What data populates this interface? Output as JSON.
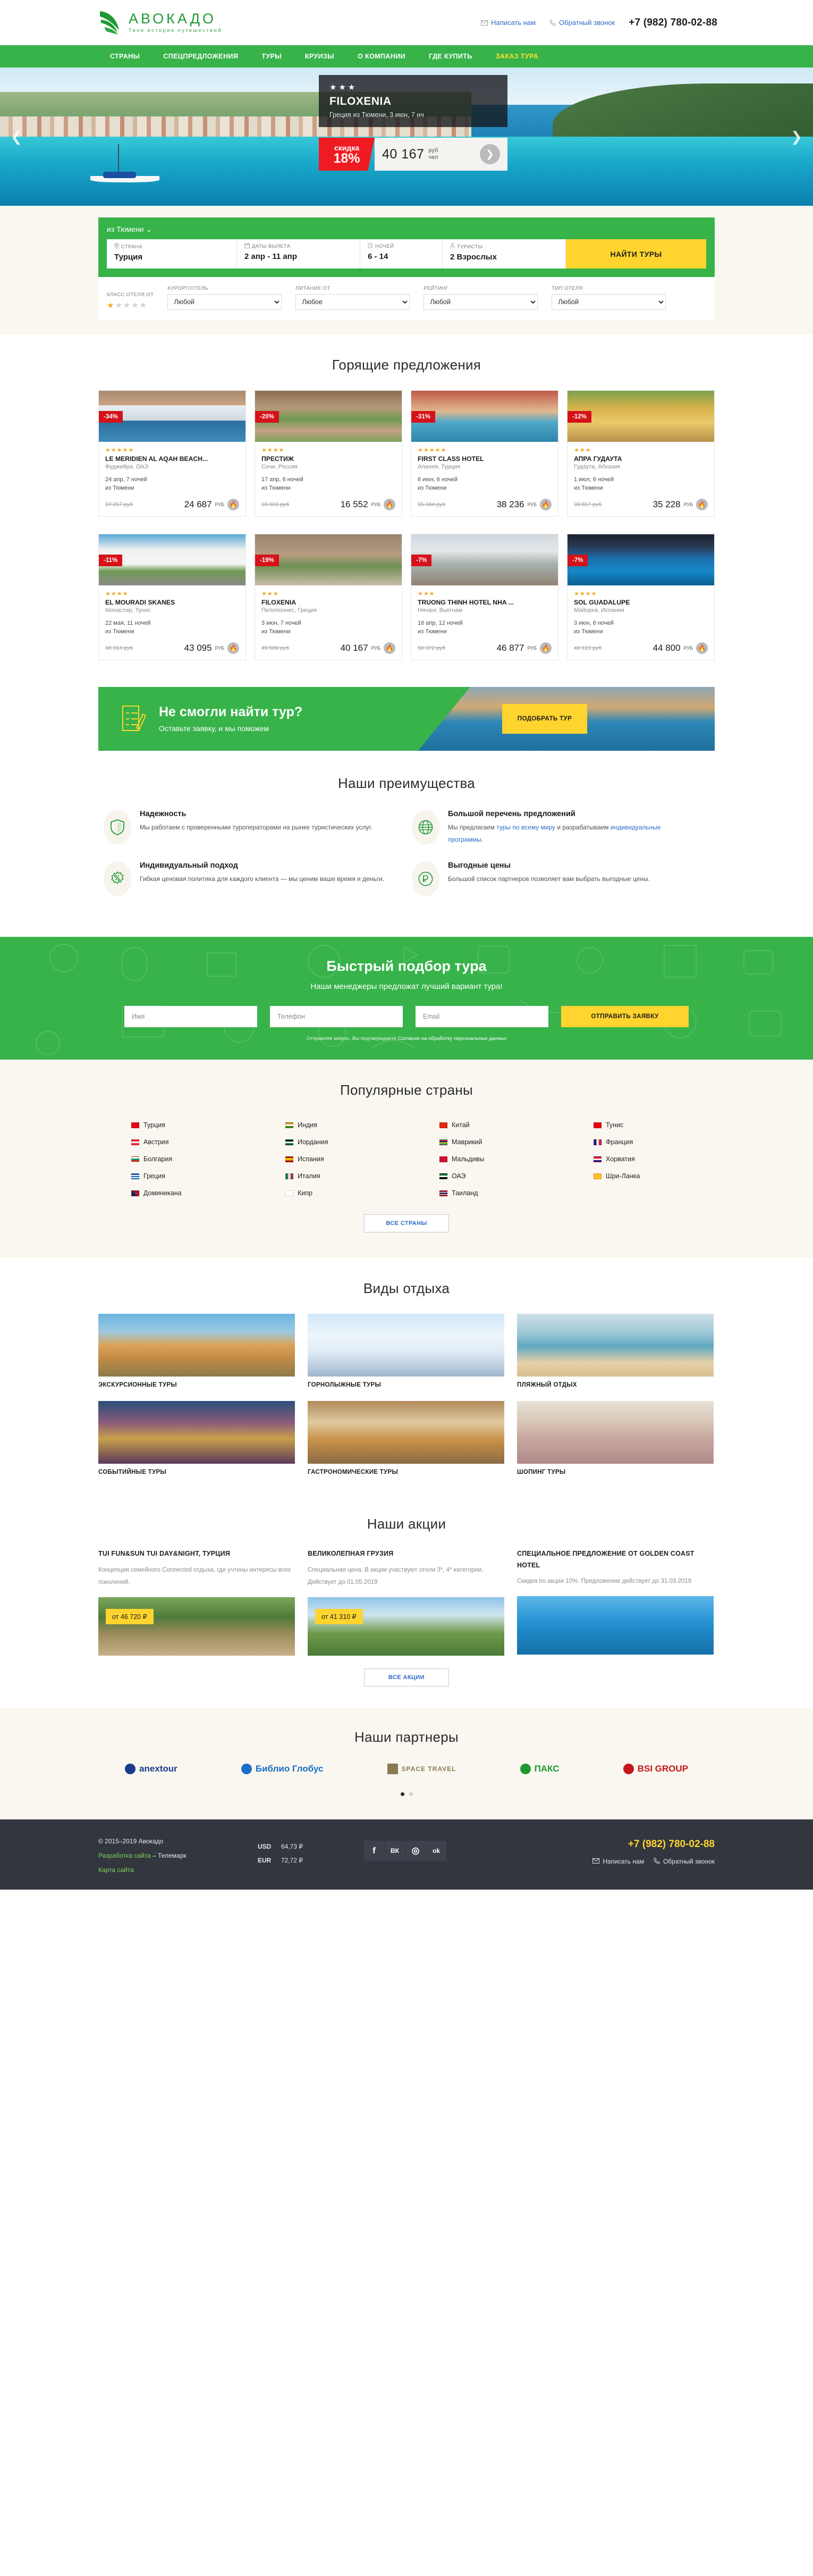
{
  "header": {
    "logo_title": "АВОКАДО",
    "logo_sub": "Твоя история путешествий",
    "write_us": "Написать нам",
    "callback": "Обратный звонок",
    "phone": "+7 (982) 780-02-88"
  },
  "nav": [
    {
      "label": "СТРАНЫ",
      "accent": false
    },
    {
      "label": "СПЕЦПРЕДЛОЖЕНИЯ",
      "accent": false
    },
    {
      "label": "ТУРЫ",
      "accent": false
    },
    {
      "label": "КРУИЗЫ",
      "accent": false
    },
    {
      "label": "О КОМПАНИИ",
      "accent": false
    },
    {
      "label": "ГДЕ КУПИТЬ",
      "accent": false
    },
    {
      "label": "ЗАКАЗ ТУРА",
      "accent": true
    }
  ],
  "hero": {
    "stars": "★★★",
    "hotel": "FILOXENIA",
    "meta": "Греция из Тюмени, 3 июн, 7 нч",
    "discount_label": "скидка",
    "discount_value": "18%",
    "price": "40 167",
    "unit_top": "руб",
    "unit_bottom": "чел",
    "prev_icon": "chevron-left-icon",
    "next_icon": "chevron-right-icon"
  },
  "search": {
    "from_city": "из Тюмени",
    "fields": [
      {
        "label": "СТРАНА",
        "value": "Турция",
        "icon": "pin-icon"
      },
      {
        "label": "ДАТЫ ВЫЛЕТА",
        "value": "2 апр - 11 апр",
        "icon": "calendar-icon"
      },
      {
        "label": "НОЧЕЙ",
        "value": "6 - 14",
        "icon": "clock-icon"
      },
      {
        "label": "ТУРИСТЫ",
        "value": "2 Взрослых",
        "icon": "person-icon"
      }
    ],
    "find_button": "НАЙТИ ТУРЫ",
    "filters": [
      {
        "label": "КЛАСС ОТЕЛЯ ОТ",
        "type": "stars",
        "filled": 1,
        "total": 5
      },
      {
        "label": "КУРОРТ/ОТЕЛЬ",
        "type": "select",
        "value": "Любой"
      },
      {
        "label": "ПИТАНИЕ ОТ",
        "type": "select",
        "value": "Любое"
      },
      {
        "label": "РЕЙТИНГ",
        "type": "select",
        "value": "Любой"
      },
      {
        "label": "ТИП ОТЕЛЯ",
        "type": "select",
        "value": "Любой"
      }
    ]
  },
  "hot_offers": {
    "title": "Горящие предложения",
    "currency": "РУБ",
    "cards": [
      {
        "discount": "-34%",
        "stars": 5,
        "name": "LE MERIDIEN AL AQAH BEACH...",
        "place": "Фуджейра, ОАЭ",
        "date": "24 апр, 7 ночей",
        "from": "из Тюмени",
        "old": "37 267",
        "new": "24 687",
        "img": "hotel-tower-mountain"
      },
      {
        "discount": "-20%",
        "stars": 4,
        "name": "ПРЕСТИЖ",
        "place": "Сочи, Россия",
        "date": "17 апр, 6 ночей",
        "from": "из Тюмени",
        "old": "20 603",
        "new": "16 552",
        "img": "hotel-prestige-garden"
      },
      {
        "discount": "-31%",
        "stars": 5,
        "name": "FIRST CLASS HOTEL",
        "place": "Алания, Турция",
        "date": "6 июн, 6 ночей",
        "from": "из Тюмени",
        "old": "55 344",
        "new": "38 236",
        "img": "hotel-pool-red"
      },
      {
        "discount": "-12%",
        "stars": 3,
        "name": "АПРА ГУДАУТА",
        "place": "Гудаута, Абхазия",
        "date": "1 июл, 6 ночей",
        "from": "из Тюмени",
        "old": "39 817",
        "new": "35 228",
        "img": "hotel-yellow-building"
      },
      {
        "discount": "-11%",
        "stars": 4,
        "name": "EL MOURADI SKANES",
        "place": "Монастир, Тунис",
        "date": "22 мая, 11 ночей",
        "from": "из Тюмени",
        "old": "48 314",
        "new": "43 095",
        "img": "hotel-white-arabic"
      },
      {
        "discount": "-19%",
        "stars": 3,
        "name": "FILOXENIA",
        "place": "Пелопоннес, Греция",
        "date": "3 июн, 7 ночей",
        "from": "из Тюмени",
        "old": "49 589",
        "new": "40 167",
        "img": "hotel-stone-greek"
      },
      {
        "discount": "-7%",
        "stars": 3,
        "name": "TRUONG THINH HOTEL NHA ...",
        "place": "Нячанг, Вьетнам",
        "date": "16 апр, 12 ночей",
        "from": "из Тюмени",
        "old": "50 372",
        "new": "46 877",
        "img": "hotel-city-vietnam"
      },
      {
        "discount": "-7%",
        "stars": 4,
        "name": "SOL GUADALUPE",
        "place": "Майорка, Испания",
        "date": "3 июн, 6 ночей",
        "from": "из Тюмени",
        "old": "48 123",
        "new": "44 800",
        "img": "hotel-night-pool"
      }
    ]
  },
  "cta": {
    "heading": "Не смогли найти тур?",
    "sub": "Оставьте заявку, и мы поможем",
    "button": "ПОДОБРАТЬ ТУР",
    "icon": "document-pencil-icon"
  },
  "advantages": {
    "title": "Наши преимущества",
    "items": [
      {
        "icon": "shield-icon",
        "heading": "Надежность",
        "text": "Мы работаем с проверенными туроператорами на рынке туристических услуг.",
        "link_text": "",
        "text_after": ""
      },
      {
        "icon": "globe-icon",
        "heading": "Большой перечень предложений",
        "text": "Мы предлагаем ",
        "link_text": "туры по всему миру",
        "text_mid": " и разрабатываем ",
        "link_text2": "индивидуальные программы",
        "text_after": "."
      },
      {
        "icon": "percent-badge-icon",
        "heading": "Индивидуальный подход",
        "text": "Гибкая ценовая политика для каждого клиента — мы ценим ваше время и деньги.",
        "link_text": "",
        "text_after": ""
      },
      {
        "icon": "ruble-circle-icon",
        "heading": "Выгодные цены",
        "text": "Большой список партнеров позволяет вам выбрать выгодные цены.",
        "link_text": "",
        "text_after": ""
      }
    ]
  },
  "quick_form": {
    "title": "Быстрый подбор тура",
    "subtitle": "Наши менеджеры предложат лучший вариант тура!",
    "name_placeholder": "Имя",
    "phone_placeholder": "Телефон",
    "email_placeholder": "Email",
    "submit": "ОТПРАВИТЬ ЗАЯВКУ",
    "note_before": "Отправляя запрос, Вы подтверждаете ",
    "note_link": "Согласие на обработку персональных данных"
  },
  "countries": {
    "title": "Популярные страны",
    "all_button": "ВСЕ СТРАНЫ",
    "items": [
      {
        "name": "Турция",
        "flag": "tr"
      },
      {
        "name": "Индия",
        "flag": "in"
      },
      {
        "name": "Китай",
        "flag": "cn"
      },
      {
        "name": "Тунис",
        "flag": "tn"
      },
      {
        "name": "Австрия",
        "flag": "at"
      },
      {
        "name": "Иордания",
        "flag": "jo"
      },
      {
        "name": "Маврикий",
        "flag": "mu"
      },
      {
        "name": "Франция",
        "flag": "fr"
      },
      {
        "name": "Болгария",
        "flag": "bg"
      },
      {
        "name": "Испания",
        "flag": "es"
      },
      {
        "name": "Мальдивы",
        "flag": "mv"
      },
      {
        "name": "Хорватия",
        "flag": "hr"
      },
      {
        "name": "Греция",
        "flag": "gr"
      },
      {
        "name": "Италия",
        "flag": "it"
      },
      {
        "name": "ОАЭ",
        "flag": "ae"
      },
      {
        "name": "Шри-Ланка",
        "flag": "lk"
      },
      {
        "name": "Доминикана",
        "flag": "do"
      },
      {
        "name": "Кипр",
        "flag": "cy"
      },
      {
        "name": "Таиланд",
        "flag": "th"
      }
    ]
  },
  "vacation_types": {
    "title": "Виды отдыха",
    "items": [
      {
        "label": "ЭКСКУРСИОННЫЕ ТУРЫ",
        "img": "colosseum"
      },
      {
        "label": "ГОРНОЛЫЖНЫЕ ТУРЫ",
        "img": "skier"
      },
      {
        "label": "ПЛЯЖНЫЙ ОТДЫХ",
        "img": "beach"
      },
      {
        "label": "СОБЫТИЙНЫЕ ТУРЫ",
        "img": "venice-carnival"
      },
      {
        "label": "ГАСТРОНОМИЧЕСКИЕ ТУРЫ",
        "img": "food-table"
      },
      {
        "label": "ШОПИНГ ТУРЫ",
        "img": "shopping-women"
      }
    ]
  },
  "promos": {
    "title": "Наши акции",
    "all_button": "ВСЕ АКЦИИ",
    "items": [
      {
        "heading": "TUI FUN&SUN TUI DAY&NIGHT, ТУРЦИЯ",
        "text": "Концепция семейного Connected отдыха, где учтены интересы всех поколений.",
        "tag": "от 46 720 ₽",
        "img": "tropical-resort"
      },
      {
        "heading": "ВЕЛИКОЛЕПНАЯ ГРУЗИЯ",
        "text": "Специальная цена. В акции участвуют отели 3*, 4* категории. Действует до 01.05.2019",
        "tag": "от 41 310 ₽",
        "img": "georgia-mountains"
      },
      {
        "heading": "СПЕЦИАЛЬНОЕ ПРЕДЛОЖЕНИЕ ОТ GOLDEN COAST HOTEL",
        "text": "Скидка по акции 10%. Предложение действует до 31.03.2019",
        "tag": "",
        "img": "golden-coast-sea"
      }
    ]
  },
  "partners": {
    "title": "Наши партнеры",
    "items": [
      {
        "name": "anextour",
        "color": "#1a3e8c"
      },
      {
        "name": "Библио Глобус",
        "color": "#1a6fc4"
      },
      {
        "name": "SPACE TRAVEL",
        "color": "#8a7a52"
      },
      {
        "name": "ПАКС",
        "color": "#1f9a33"
      },
      {
        "name": "BSI GROUP",
        "color": "#c4161c"
      }
    ],
    "dots": 2,
    "active_dot": 0
  },
  "footer": {
    "copyright": "© 2015–2019 Авокадо",
    "dev_link": "Разработка сайта",
    "dev_dash": " – Телемарк",
    "sitemap": "Карта сайта",
    "rates": [
      {
        "code": "USD",
        "value": "64,73 ₽"
      },
      {
        "code": "EUR",
        "value": "72,72 ₽"
      }
    ],
    "socials": [
      "facebook-icon",
      "vk-icon",
      "instagram-icon",
      "odnoklassniki-icon"
    ],
    "phone": "+7 (982) 780-02-88",
    "write_us": "Написать нам",
    "callback": "Обратный звонок"
  }
}
